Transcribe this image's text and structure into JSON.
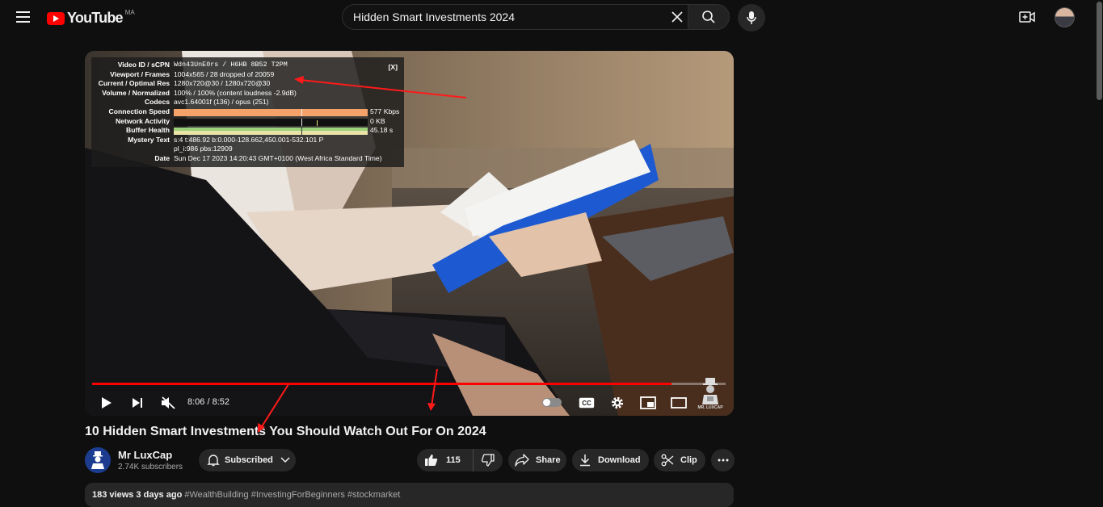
{
  "masthead": {
    "logo_text": "YouTube",
    "country_code": "MA",
    "search_value": "Hidden Smart Investments 2024",
    "icons": [
      "menu-icon",
      "search-icon",
      "clear-icon",
      "mic-icon",
      "create-video-icon"
    ]
  },
  "stats": {
    "close_label": "[X]",
    "rows": [
      {
        "label": "Video ID / sCPN",
        "value": "Wdn43UnE0rs / H6HB 8B52 T2PM"
      },
      {
        "label": "Viewport / Frames",
        "value": "1004x565 / 28 dropped of 20059"
      },
      {
        "label": "Current / Optimal Res",
        "value": "1280x720@30 / 1280x720@30"
      },
      {
        "label": "Volume / Normalized",
        "value": "100% / 100% (content loudness -2.9dB)"
      },
      {
        "label": "Codecs",
        "value": "avc1.64001f (136) / opus (251)"
      },
      {
        "label": "Connection Speed",
        "value": "577 Kbps"
      },
      {
        "label": "Network Activity",
        "value": "0 KB"
      },
      {
        "label": "Buffer Health",
        "value": "45.18 s"
      },
      {
        "label": "Mystery Text",
        "value": "s:4 t:486.92 b:0.000-128.662,450.001-532.101 P"
      },
      {
        "label": "",
        "value": "pl_i:986 pbs:12909"
      },
      {
        "label": "Date",
        "value": "Sun Dec 17 2023 14:20:43 GMT+0100 (West Africa Standard Time)"
      }
    ],
    "bar_colors": {
      "connection": "#f5a26a",
      "network": "#000000",
      "buffer_top": "#9bd27a",
      "buffer_bottom": "#e9e3a8"
    }
  },
  "player": {
    "time_display": "8:06 / 8:52",
    "progress_fraction": 0.914,
    "accent": "#ff0000",
    "watermark_text": "MR. LUXCAP",
    "icons": [
      "play-icon",
      "next-icon",
      "muted-icon",
      "autoplay-toggle",
      "subtitles-icon",
      "settings-icon",
      "miniplayer-icon",
      "theater-icon"
    ],
    "cc_label": "CC"
  },
  "video": {
    "title": "10 Hidden Smart Investments You Should Watch Out For On 2024",
    "channel_name": "Mr LuxCap",
    "subscribers": "2.74K subscribers",
    "avatar_text": "MR. LUXCAP"
  },
  "actions": {
    "subscribed": "Subscribed",
    "likes": "115",
    "share": "Share",
    "download": "Download",
    "clip": "Clip"
  },
  "description": {
    "meta": "183 views  3 days ago",
    "tags": "#WealthBuilding #InvestingForBeginners #stockmarket"
  }
}
